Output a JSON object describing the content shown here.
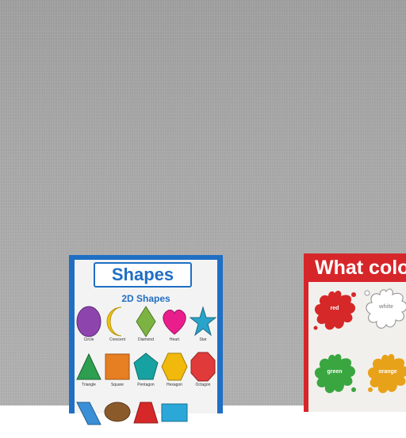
{
  "shapes_poster": {
    "title": "Shapes",
    "subtitle": "2D Shapes",
    "frame_color": "#1f6fc4",
    "shapes": [
      {
        "label": "Circle",
        "icon": "circle-icon",
        "color": "#8e44ad"
      },
      {
        "label": "Crescent",
        "icon": "crescent-icon",
        "color": "#f1c40f"
      },
      {
        "label": "Diamond",
        "icon": "diamond-icon",
        "color": "#7cb342"
      },
      {
        "label": "Heart",
        "icon": "heart-icon",
        "color": "#e91e8c"
      },
      {
        "label": "Star",
        "icon": "star-icon",
        "color": "#29a3c9"
      },
      {
        "label": "Triangle",
        "icon": "triangle-icon",
        "color": "#2e9e4f"
      },
      {
        "label": "Square",
        "icon": "square-icon",
        "color": "#e67e22"
      },
      {
        "label": "Pentagon",
        "icon": "pentagon-icon",
        "color": "#16a2a0"
      },
      {
        "label": "Hexagon",
        "icon": "hexagon-icon",
        "color": "#f0b90b"
      },
      {
        "label": "Octagon",
        "icon": "octagon-icon",
        "color": "#e03a3a"
      },
      {
        "label": "",
        "icon": "parallelogram-icon",
        "color": "#3a8fd6"
      },
      {
        "label": "",
        "icon": "oval-icon",
        "color": "#8b5a2b"
      },
      {
        "label": "",
        "icon": "trapezoid-icon",
        "color": "#d62828"
      },
      {
        "label": "",
        "icon": "rectangle-icon",
        "color": "#2ba8d8"
      }
    ]
  },
  "color_poster": {
    "title": "What color",
    "frame_color": "#d7262a",
    "splats": [
      {
        "label": "red",
        "color": "#d62828"
      },
      {
        "label": "white",
        "color": "#ffffff"
      },
      {
        "label": "green",
        "color": "#3aa640"
      },
      {
        "label": "orange",
        "color": "#e8a21a"
      }
    ]
  }
}
